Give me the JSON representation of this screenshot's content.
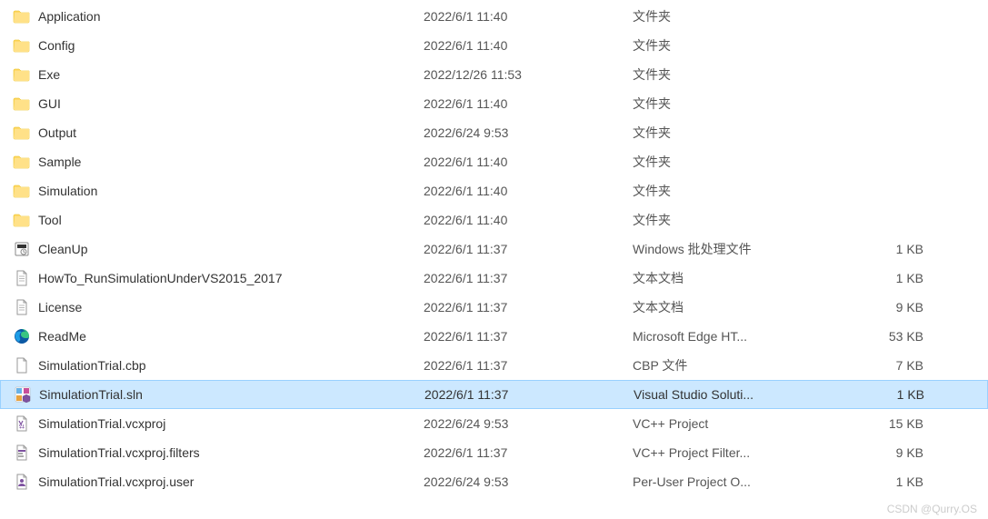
{
  "watermark": "CSDN @Qurry.OS",
  "files": [
    {
      "icon": "folder",
      "name": "Application",
      "date": "2022/6/1 11:40",
      "type": "文件夹",
      "size": "",
      "selected": false
    },
    {
      "icon": "folder",
      "name": "Config",
      "date": "2022/6/1 11:40",
      "type": "文件夹",
      "size": "",
      "selected": false
    },
    {
      "icon": "folder",
      "name": "Exe",
      "date": "2022/12/26 11:53",
      "type": "文件夹",
      "size": "",
      "selected": false
    },
    {
      "icon": "folder",
      "name": "GUI",
      "date": "2022/6/1 11:40",
      "type": "文件夹",
      "size": "",
      "selected": false
    },
    {
      "icon": "folder",
      "name": "Output",
      "date": "2022/6/24 9:53",
      "type": "文件夹",
      "size": "",
      "selected": false
    },
    {
      "icon": "folder",
      "name": "Sample",
      "date": "2022/6/1 11:40",
      "type": "文件夹",
      "size": "",
      "selected": false
    },
    {
      "icon": "folder",
      "name": "Simulation",
      "date": "2022/6/1 11:40",
      "type": "文件夹",
      "size": "",
      "selected": false
    },
    {
      "icon": "folder",
      "name": "Tool",
      "date": "2022/6/1 11:40",
      "type": "文件夹",
      "size": "",
      "selected": false
    },
    {
      "icon": "batch",
      "name": "CleanUp",
      "date": "2022/6/1 11:37",
      "type": "Windows 批处理文件",
      "size": "1 KB",
      "selected": false
    },
    {
      "icon": "text",
      "name": "HowTo_RunSimulationUnderVS2015_2017",
      "date": "2022/6/1 11:37",
      "type": "文本文档",
      "size": "1 KB",
      "selected": false
    },
    {
      "icon": "text",
      "name": "License",
      "date": "2022/6/1 11:37",
      "type": "文本文档",
      "size": "9 KB",
      "selected": false
    },
    {
      "icon": "edge",
      "name": "ReadMe",
      "date": "2022/6/1 11:37",
      "type": "Microsoft Edge HT...",
      "size": "53 KB",
      "selected": false
    },
    {
      "icon": "file",
      "name": "SimulationTrial.cbp",
      "date": "2022/6/1 11:37",
      "type": "CBP 文件",
      "size": "7 KB",
      "selected": false
    },
    {
      "icon": "sln",
      "name": "SimulationTrial.sln",
      "date": "2022/6/1 11:37",
      "type": "Visual Studio Soluti...",
      "size": "1 KB",
      "selected": true
    },
    {
      "icon": "vcxproj",
      "name": "SimulationTrial.vcxproj",
      "date": "2022/6/24 9:53",
      "type": "VC++ Project",
      "size": "15 KB",
      "selected": false
    },
    {
      "icon": "vcxfilters",
      "name": "SimulationTrial.vcxproj.filters",
      "date": "2022/6/1 11:37",
      "type": "VC++ Project Filter...",
      "size": "9 KB",
      "selected": false
    },
    {
      "icon": "vcxuser",
      "name": "SimulationTrial.vcxproj.user",
      "date": "2022/6/24 9:53",
      "type": "Per-User Project O...",
      "size": "1 KB",
      "selected": false
    }
  ]
}
